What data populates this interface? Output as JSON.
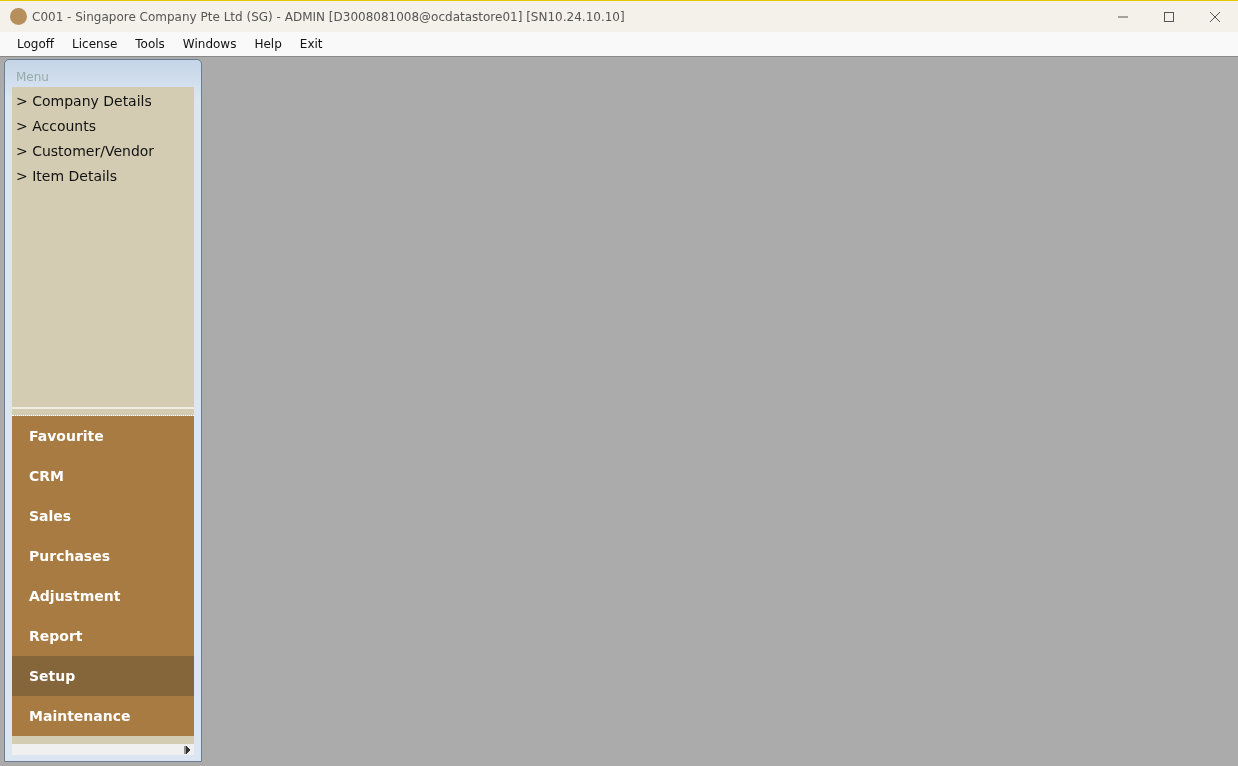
{
  "window": {
    "title": "C001 - Singapore Company Pte Ltd (SG) - ADMIN [D3008081008@ocdatastore01] [SN10.24.10.10]"
  },
  "menu_bar": [
    "Logoff",
    "License",
    "Tools",
    "Windows",
    "Help",
    "Exit"
  ],
  "sidebar": {
    "title": "Menu",
    "items": [
      {
        "label": "> Company Details"
      },
      {
        "label": "> Accounts"
      },
      {
        "label": "> Customer/Vendor"
      },
      {
        "label": "> Item Details"
      }
    ],
    "sections": [
      {
        "label": "Favourite",
        "selected": false
      },
      {
        "label": "CRM",
        "selected": false
      },
      {
        "label": "Sales",
        "selected": false
      },
      {
        "label": "Purchases",
        "selected": false
      },
      {
        "label": "Adjustment",
        "selected": false
      },
      {
        "label": "Report",
        "selected": false
      },
      {
        "label": "Setup",
        "selected": true
      },
      {
        "label": "Maintenance",
        "selected": false
      }
    ]
  }
}
